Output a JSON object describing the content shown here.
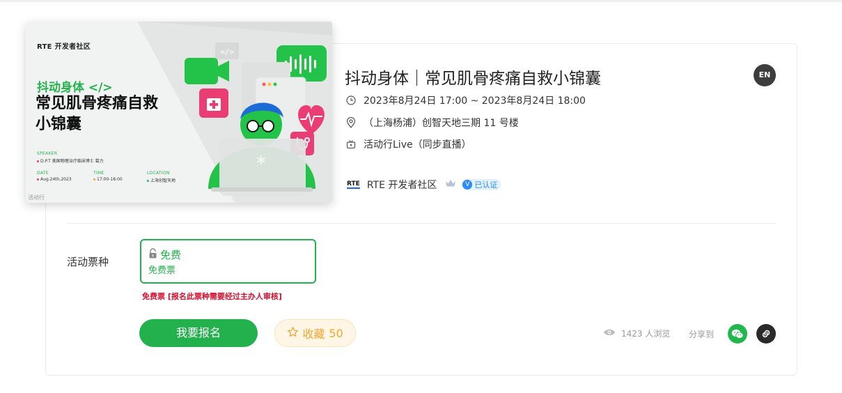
{
  "event": {
    "title": "抖动身体｜常见肌骨疼痛自救小锦囊",
    "lang_badge": "EN",
    "time": "2023年8月24日 17:00 ~ 2023年8月24日 18:00",
    "location": "（上海杨浦）创智天地三期 11 号楼",
    "channel": "活动行Live（同步直播）",
    "organizer": "RTE 开发者社区",
    "organizer_logo": "RTE",
    "verified_label": "已认证",
    "verified_mark": "V"
  },
  "poster": {
    "brand": "RTE 开发者社区",
    "headline": "抖动身体 </>",
    "title_line1": "常见肌骨疼痛自救",
    "title_line2": "小锦囊",
    "speaker_label": "SPEAKER",
    "speaker": "D.P.T 美国物理治疗临床博士 葛力",
    "date_label": "DATE",
    "date": "Aug.24th,2023",
    "time_label": "TIME",
    "time": "17:00-18:00",
    "location_label": "LOCATION",
    "location": "上海创智天地",
    "footer": "活动行",
    "code_tag": "</>",
    "asterisk": "*"
  },
  "tickets": {
    "label": "活动票种",
    "items": [
      {
        "name": "免费",
        "subtitle": "免费票"
      }
    ],
    "note": "免费票 [报名此票种需要经过主办人审核]"
  },
  "actions": {
    "register": "我要报名",
    "favorite": "收藏",
    "favorite_count": "50",
    "views": "1423 人浏览",
    "share_label": "分享到"
  },
  "colors": {
    "brand_green": "#22b14c",
    "note_red": "#d3112e",
    "favorite_orange": "#f3a531",
    "verified_blue": "#2c8cf4"
  }
}
